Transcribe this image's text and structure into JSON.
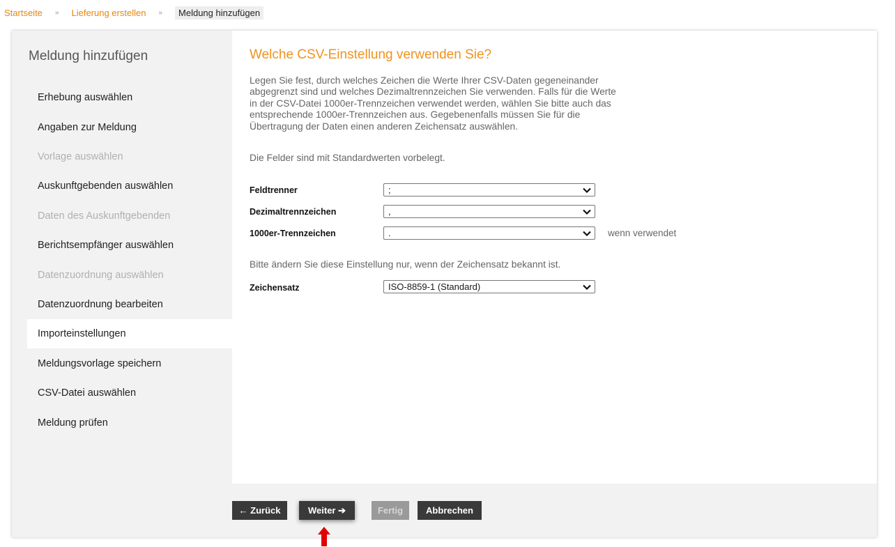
{
  "breadcrumb": {
    "items": [
      "Startseite",
      "Lieferung erstellen"
    ],
    "current": "Meldung hinzufügen",
    "separator": "»"
  },
  "sidebar": {
    "title": "Meldung hinzufügen",
    "items": [
      {
        "label": "Erhebung auswählen",
        "state": "normal"
      },
      {
        "label": "Angaben zur Meldung",
        "state": "normal"
      },
      {
        "label": "Vorlage auswählen",
        "state": "disabled"
      },
      {
        "label": "Auskunftgebenden auswählen",
        "state": "normal"
      },
      {
        "label": "Daten des Auskunftgebenden",
        "state": "disabled"
      },
      {
        "label": "Berichtsempfänger auswählen",
        "state": "normal"
      },
      {
        "label": "Datenzuordnung auswählen",
        "state": "disabled"
      },
      {
        "label": "Datenzuordnung bearbeiten",
        "state": "normal"
      },
      {
        "label": "Importeinstellungen",
        "state": "active"
      },
      {
        "label": "Meldungsvorlage speichern",
        "state": "normal"
      },
      {
        "label": "CSV-Datei auswählen",
        "state": "normal"
      },
      {
        "label": "Meldung prüfen",
        "state": "normal"
      }
    ]
  },
  "content": {
    "title": "Welche CSV-Einstellung verwenden Sie?",
    "intro_lines": [
      "Legen Sie fest, durch welches Zeichen die Werte Ihrer CSV-Daten gegeneinander",
      "abgegrenzt sind und welches Dezimaltrennzeichen Sie verwenden. Falls für die Werte",
      "in der CSV-Datei 1000er-Trennzeichen verwendet werden, wählen Sie bitte auch das",
      "entsprechende 1000er-Trennzeichen aus. Gegebenenfalls müssen Sie für die",
      "Übertragung der Daten einen anderen Zeichensatz auswählen."
    ],
    "defaults_note": "Die Felder sind mit Standardwerten vorbelegt.",
    "charset_note": "Bitte ändern Sie diese Einstellung nur, wenn der Zeichensatz bekannt ist.",
    "fields": {
      "feldtrenner": {
        "label": "Feldtrenner",
        "value": ";"
      },
      "dezimal": {
        "label": "Dezimaltrennzeichen",
        "value": ","
      },
      "tausender": {
        "label": "1000er-Trennzeichen",
        "value": ".",
        "hint": "wenn verwendet"
      },
      "zeichensatz": {
        "label": "Zeichensatz",
        "value": "ISO-8859-1 (Standard)"
      }
    }
  },
  "buttons": {
    "back": "← Zurück",
    "next": "Weiter ➔",
    "finish": "Fertig",
    "cancel": "Abbrechen"
  },
  "colors": {
    "accent": "#f0921d",
    "link": "#e8870a",
    "button": "#3a3a3a",
    "indicator": "#e00000"
  },
  "icons": {
    "select_arrow": "chevron-down-icon",
    "indicator": "arrow-up-icon"
  }
}
